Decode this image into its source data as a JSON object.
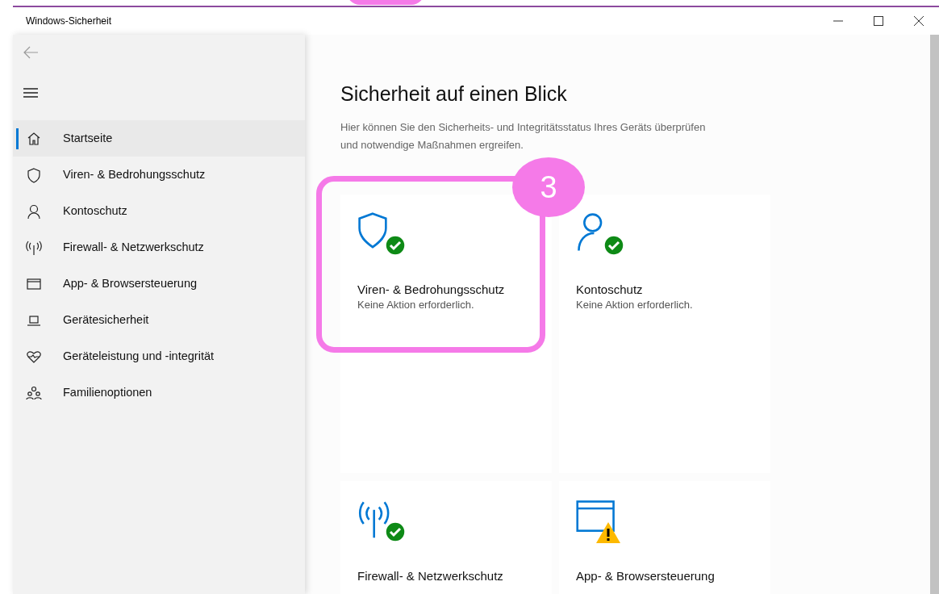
{
  "window": {
    "title": "Windows-Sicherheit"
  },
  "sidebar": {
    "items": [
      {
        "label": "Startseite",
        "selected": true
      },
      {
        "label": "Viren- & Bedrohungsschutz",
        "selected": false
      },
      {
        "label": "Kontoschutz",
        "selected": false
      },
      {
        "label": "Firewall- & Netzwerkschutz",
        "selected": false
      },
      {
        "label": "App- & Browsersteuerung",
        "selected": false
      },
      {
        "label": "Gerätesicherheit",
        "selected": false
      },
      {
        "label": "Geräteleistung und -integrität",
        "selected": false
      },
      {
        "label": "Familienoptionen",
        "selected": false
      }
    ]
  },
  "page": {
    "title": "Sicherheit auf einen Blick",
    "description": "Hier können Sie den Sicherheits- und Integritätsstatus Ihres Geräts überprüfen und notwendige Maßnahmen ergreifen."
  },
  "tiles": [
    {
      "title": "Viren- & Bedrohungsschutz",
      "subtitle": "Keine Aktion erforderlich.",
      "kind": "ok"
    },
    {
      "title": "Kontoschutz",
      "subtitle": "Keine Aktion erforderlich.",
      "kind": "ok"
    },
    {
      "title": "Firewall- & Netzwerkschutz",
      "kind": "ok"
    },
    {
      "title": "App- & Browsersteuerung",
      "kind": "warning"
    }
  ],
  "annotation": {
    "label": "3"
  }
}
